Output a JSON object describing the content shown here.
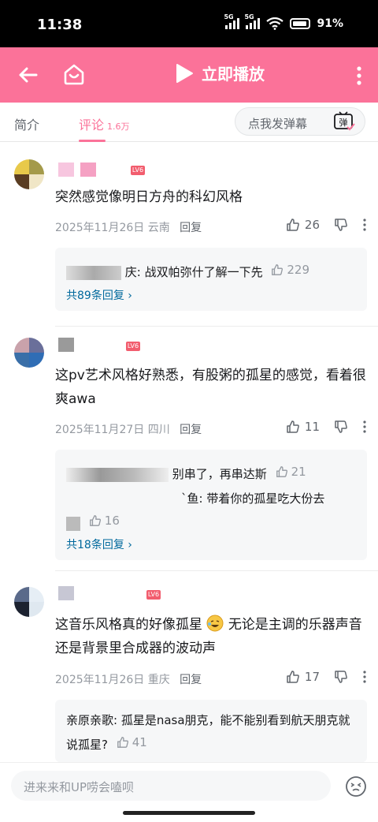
{
  "status_bar": {
    "time": "11:38",
    "network1": "5G",
    "network2": "5G",
    "battery": "91%"
  },
  "top_bar": {
    "play_label": "立即播放"
  },
  "tabs": [
    {
      "label": "简介",
      "count": ""
    },
    {
      "label": "评论",
      "count": "1.6万"
    }
  ],
  "danmaku": {
    "placeholder": "点我发弹幕",
    "icon_text": "弹"
  },
  "comments": [
    {
      "text": "突然感觉像明日方舟的科幻风格",
      "date": "2025年11月26日",
      "location": "云南",
      "reply_label": "回复",
      "likes": "26",
      "replies": [
        {
          "text": "庆: 战双帕弥什了解一下先",
          "likes": "229"
        }
      ],
      "more_replies": "共89条回复"
    },
    {
      "text": "这pv艺术风格好熟悉，有股粥的孤星的感觉，看着很爽awa",
      "date": "2025年11月27日",
      "location": "四川",
      "reply_label": "回复",
      "likes": "11",
      "replies": [
        {
          "text": "别串了，再串达斯",
          "likes": "21"
        },
        {
          "text": "`鱼: 带着你的孤星吃大份去",
          "likes": "16"
        }
      ],
      "more_replies": "共18条回复"
    },
    {
      "text": "这音乐风格真的好像孤星",
      "text_after_emoji": "无论是主调的乐器声音还是背景里合成器的波动声",
      "date": "2025年11月26日",
      "location": "重庆",
      "reply_label": "回复",
      "likes": "17",
      "replies": [
        {
          "text": "亲原亲歌: 孤星是nasa朋克，能不能别看到航天朋克就说孤星?",
          "likes": "41"
        }
      ]
    }
  ],
  "input_bar": {
    "placeholder": "进来来和UP唠会嗑呗"
  },
  "colors": {
    "brand": "#fb7299",
    "link": "#00699d",
    "meta": "#9499a0"
  }
}
